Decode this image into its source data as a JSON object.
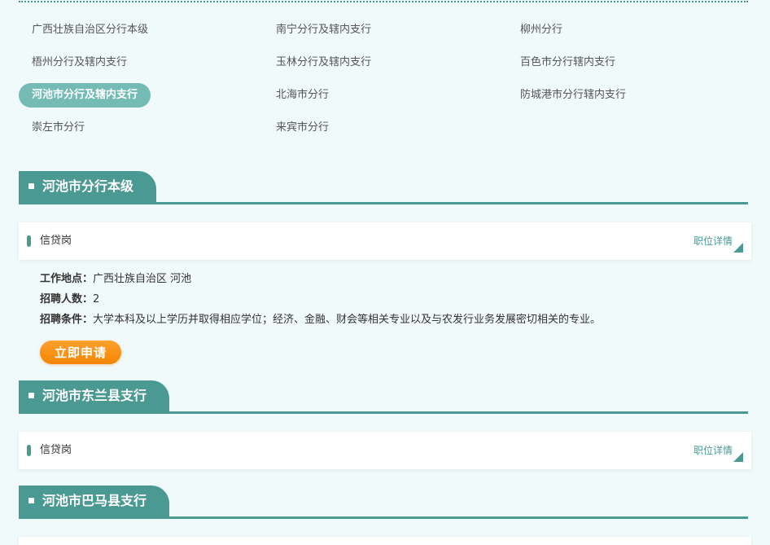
{
  "branches": [
    {
      "label": "广西壮族自治区分行本级",
      "active": false
    },
    {
      "label": "南宁分行及辖内支行",
      "active": false
    },
    {
      "label": "柳州分行",
      "active": false
    },
    {
      "label": "梧州分行及辖内支行",
      "active": false
    },
    {
      "label": "玉林分行及辖内支行",
      "active": false
    },
    {
      "label": "百色市分行辖内支行",
      "active": false
    },
    {
      "label": "河池市分行及辖内支行",
      "active": true
    },
    {
      "label": "北海市分行",
      "active": false
    },
    {
      "label": "防城港市分行辖内支行",
      "active": false
    },
    {
      "label": "崇左市分行",
      "active": false
    },
    {
      "label": "来宾市分行",
      "active": false
    }
  ],
  "sections": [
    {
      "title": "河池市分行本级",
      "job": {
        "title": "信贷岗",
        "detail_label": "职位详情",
        "location_label": "工作地点：",
        "location": "广西壮族自治区 河池",
        "count_label": "招聘人数：",
        "count": "2",
        "requirement_label": "招聘条件：",
        "requirement": "大学本科及以上学历并取得相应学位；经济、金融、财会等相关专业以及与农发行业务发展密切相关的专业。",
        "apply_label": "立即申请"
      }
    },
    {
      "title": "河池市东兰县支行",
      "job": {
        "title": "信贷岗",
        "detail_label": "职位详情"
      }
    },
    {
      "title": "河池市巴马县支行"
    }
  ],
  "colors": {
    "accent": "#4b9993",
    "active_tab": "#74bab5",
    "apply": "#f58500",
    "background": "#f1fafa"
  }
}
